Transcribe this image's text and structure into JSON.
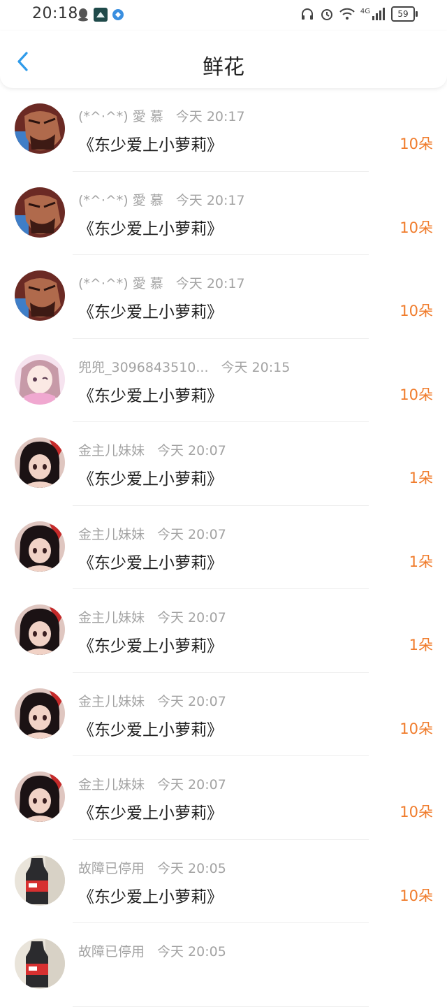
{
  "status_bar": {
    "time": "20:18",
    "battery": "59",
    "network": "4G"
  },
  "header": {
    "title": "鲜花"
  },
  "colors": {
    "accent": "#2f9bea",
    "count": "#f07c2c",
    "meta": "#a3a3a3"
  },
  "items": [
    {
      "user": "(*^·^*) 愛 慕",
      "time": "今天 20:17",
      "book": "《东少爱上小萝莉》",
      "count": "10朵",
      "avatar": "man-avatar"
    },
    {
      "user": "(*^·^*) 愛 慕",
      "time": "今天 20:17",
      "book": "《东少爱上小萝莉》",
      "count": "10朵",
      "avatar": "man-avatar"
    },
    {
      "user": "(*^·^*) 愛 慕",
      "time": "今天 20:17",
      "book": "《东少爱上小萝莉》",
      "count": "10朵",
      "avatar": "man-avatar"
    },
    {
      "user": "兜兜_3096843510...",
      "time": "今天 20:15",
      "book": "《东少爱上小萝莉》",
      "count": "10朵",
      "avatar": "anime-pink-avatar"
    },
    {
      "user": "金主儿妹妹",
      "time": "今天 20:07",
      "book": "《东少爱上小萝莉》",
      "count": "1朵",
      "avatar": "anime-girl-avatar"
    },
    {
      "user": "金主儿妹妹",
      "time": "今天 20:07",
      "book": "《东少爱上小萝莉》",
      "count": "1朵",
      "avatar": "anime-girl-avatar"
    },
    {
      "user": "金主儿妹妹",
      "time": "今天 20:07",
      "book": "《东少爱上小萝莉》",
      "count": "1朵",
      "avatar": "anime-girl-avatar"
    },
    {
      "user": "金主儿妹妹",
      "time": "今天 20:07",
      "book": "《东少爱上小萝莉》",
      "count": "10朵",
      "avatar": "anime-girl-avatar"
    },
    {
      "user": "金主儿妹妹",
      "time": "今天 20:07",
      "book": "《东少爱上小萝莉》",
      "count": "10朵",
      "avatar": "anime-girl-avatar"
    },
    {
      "user": "故障已停用",
      "time": "今天 20:05",
      "book": "《东少爱上小萝莉》",
      "count": "10朵",
      "avatar": "bottle-avatar"
    },
    {
      "user": "故障已停用",
      "time": "今天 20:05",
      "book": "",
      "count": "",
      "avatar": "bottle-avatar"
    }
  ]
}
